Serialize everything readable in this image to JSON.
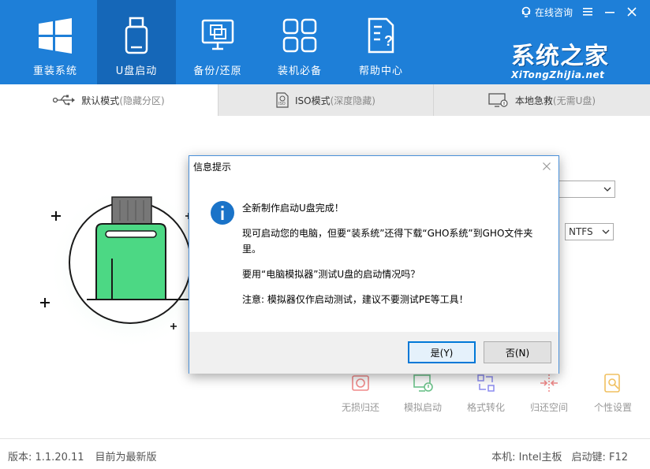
{
  "header": {
    "nav": [
      {
        "label": "重装系统",
        "icon": "windows-icon"
      },
      {
        "label": "U盘启动",
        "icon": "usb-drive-icon"
      },
      {
        "label": "备份/还原",
        "icon": "backup-restore-icon"
      },
      {
        "label": "装机必备",
        "icon": "apps-grid-icon"
      },
      {
        "label": "帮助中心",
        "icon": "help-document-icon"
      }
    ],
    "consult": "在线咨询",
    "logo_cn": "系统之家",
    "logo_en": "XiTongZhiJia.net"
  },
  "tabs": [
    {
      "label": "默认模式",
      "sub": "(隐藏分区)"
    },
    {
      "label": "ISO模式",
      "sub": "(深度隐藏)"
    },
    {
      "label": "本地急救",
      "sub": "(无需U盘)"
    }
  ],
  "main": {
    "partition_format": "NTFS"
  },
  "tools": [
    {
      "label": "无损归还",
      "icon": "lossless-restore-icon"
    },
    {
      "label": "模拟启动",
      "icon": "simulate-boot-icon"
    },
    {
      "label": "格式转化",
      "icon": "format-convert-icon"
    },
    {
      "label": "归还空间",
      "icon": "restore-space-icon"
    },
    {
      "label": "个性设置",
      "icon": "personalize-icon"
    }
  ],
  "status": {
    "version": "版本: 1.1.20.11",
    "update": "目前为最新版",
    "machine": "本机: Intel主板",
    "hotkey": "启动键: F12"
  },
  "dialog": {
    "title": "信息提示",
    "line1": "全新制作启动U盘完成！",
    "line2": "现可启动您的电脑，但要“装系统”还得下载“GHO系统”到GHO文件夹里。",
    "line3": "要用“电脑模拟器”测试U盘的启动情况吗？",
    "line4": "注意: 模拟器仅作启动测试，建议不要测试PE等工具！",
    "yes": "是(Y)",
    "no": "否(N)"
  },
  "colors": {
    "header_bg": "#1e7fd8",
    "header_active": "#1567b8",
    "usb_green": "#4cd884",
    "dialog_border": "#4a90d9",
    "info_blue": "#1a73c8"
  }
}
